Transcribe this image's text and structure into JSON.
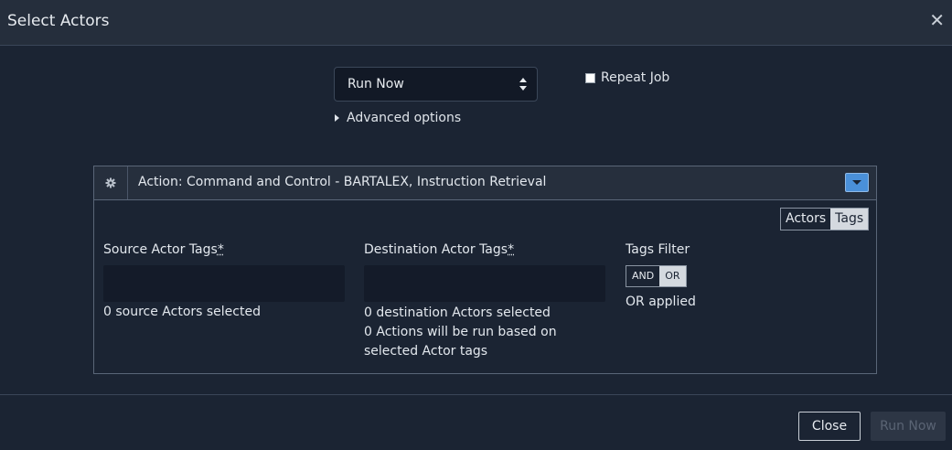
{
  "dialog": {
    "title": "Select Actors",
    "close_icon": "close-icon"
  },
  "schedule": {
    "selected": "Run Now",
    "options": [
      "Run Now"
    ],
    "repeat_label": "Repeat Job",
    "repeat_checked": false
  },
  "advanced": {
    "label": "Advanced options"
  },
  "action": {
    "title": "Action: Command and Control - BARTALEX, Instruction Retrieval",
    "gear_icon": "gear-icon",
    "mode_toggle": {
      "actors_label": "Actors",
      "tags_label": "Tags",
      "active": "Tags"
    },
    "source": {
      "label": "Source Actor Tags",
      "required": "*",
      "value": "",
      "status": "0 source Actors selected"
    },
    "destination": {
      "label": "Destination Actor Tags",
      "required": "*",
      "value": "",
      "status": "0 destination Actors selected",
      "note": "0 Actions will be run based on selected Actor tags"
    },
    "filter": {
      "label": "Tags Filter",
      "and_label": "AND",
      "or_label": "OR",
      "active": "OR",
      "status": "OR applied"
    }
  },
  "footer": {
    "close_label": "Close",
    "run_label": "Run Now"
  },
  "colors": {
    "background": "#1b2433",
    "header": "#252e3c",
    "accent": "#4a90d9",
    "field": "#141b29"
  }
}
